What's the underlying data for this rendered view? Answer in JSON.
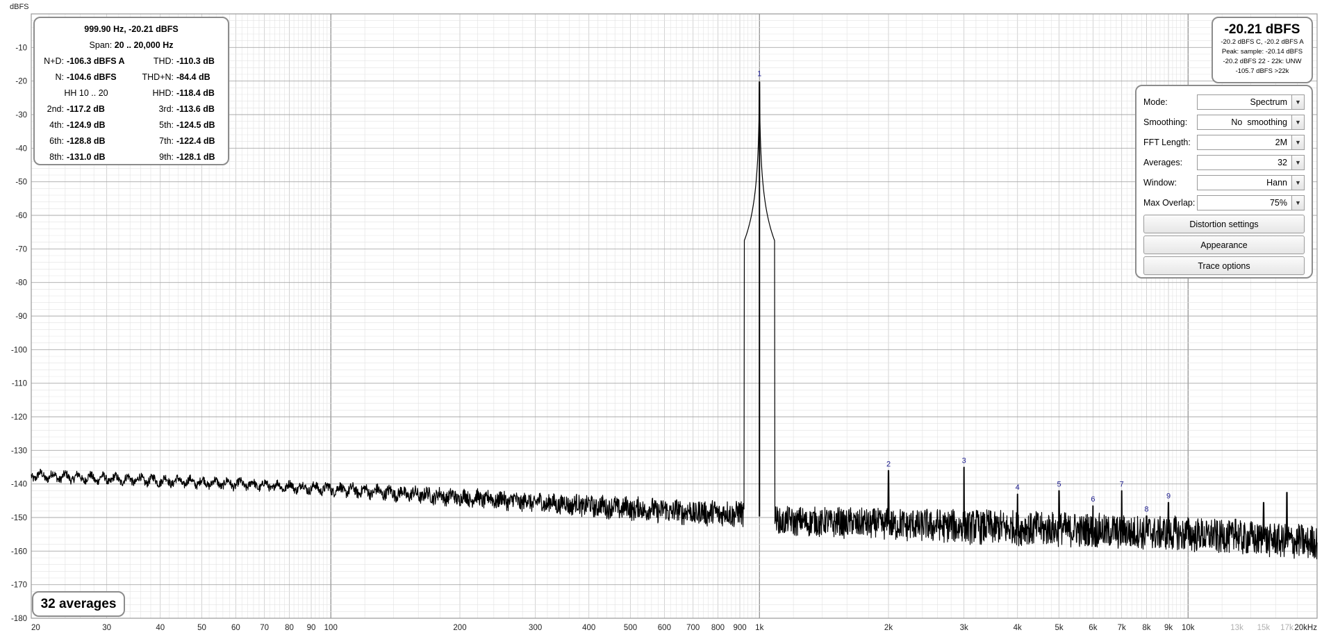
{
  "stats": {
    "line1": "999.90 Hz, -20.21 dBFS",
    "span_label": "Span:",
    "span_value": "20 .. 20,000 Hz",
    "nd_label": "N+D:",
    "nd_value": "-106.3 dBFS A",
    "thd_label": "THD:",
    "thd_value": "-110.3 dB",
    "n_label": "N:",
    "n_value": "-104.6 dBFS",
    "thdn_label": "THD+N:",
    "thdn_value": "-84.4 dB",
    "hh_label": "HH 10 .. 20",
    "hhd_label": "HHD:",
    "hhd_value": "-118.4 dB",
    "h2_label": "2nd:",
    "h2_value": "-117.2 dB",
    "h3_label": "3rd:",
    "h3_value": "-113.6 dB",
    "h4_label": "4th:",
    "h4_value": "-124.9 dB",
    "h5_label": "5th:",
    "h5_value": "-124.5 dB",
    "h6_label": "6th:",
    "h6_value": "-128.8 dB",
    "h7_label": "7th:",
    "h7_value": "-122.4 dB",
    "h8_label": "8th:",
    "h8_value": "-131.0 dB",
    "h9_label": "9th:",
    "h9_value": "-128.1 dB"
  },
  "level": {
    "big": "-20.21 dBFS",
    "line1": "-20.2 dBFS C, -20.2 dBFS A",
    "line2": "Peak: sample: -20.14 dBFS",
    "line3": "-20.2 dBFS 22 - 22k: UNW",
    "line4": "-105.7 dBFS >22k"
  },
  "controls": {
    "mode_label": "Mode:",
    "mode_value": "Spectrum",
    "smoothing_label": "Smoothing:",
    "smoothing_value": "No  smoothing",
    "fft_label": "FFT Length:",
    "fft_value": "2M",
    "averages_label": "Averages:",
    "averages_value": "32",
    "window_label": "Window:",
    "window_value": "Hann",
    "overlap_label": "Max Overlap:",
    "overlap_value": "75%",
    "distortion_button": "Distortion settings",
    "appearance_button": "Appearance",
    "trace_button": "Trace options"
  },
  "averages_badge": "32 averages",
  "icons": {
    "dropdown": "chevron-down-icon"
  },
  "colors": {
    "trace": "#000000",
    "marker_text": "#1a1a8c",
    "grid_major": "#a8a8a8",
    "grid_minor": "#e2e2e2",
    "panel_border": "#8c8c8c"
  },
  "chart_data": {
    "type": "line",
    "ylabel": "dBFS",
    "xscale": "log",
    "xlim": [
      20,
      20000
    ],
    "ylim": [
      -180,
      0
    ],
    "grid": true,
    "y_ticks": [
      -10,
      -20,
      -30,
      -40,
      -50,
      -60,
      -70,
      -80,
      -90,
      -100,
      -110,
      -120,
      -130,
      -140,
      -150,
      -160,
      -170,
      -180
    ],
    "x_ticks": [
      {
        "v": 20,
        "t": "20"
      },
      {
        "v": 30,
        "t": "30"
      },
      {
        "v": 40,
        "t": "40"
      },
      {
        "v": 50,
        "t": "50"
      },
      {
        "v": 60,
        "t": "60"
      },
      {
        "v": 70,
        "t": "70"
      },
      {
        "v": 80,
        "t": "80"
      },
      {
        "v": 90,
        "t": "90"
      },
      {
        "v": 100,
        "t": "100"
      },
      {
        "v": 200,
        "t": "200"
      },
      {
        "v": 300,
        "t": "300"
      },
      {
        "v": 400,
        "t": "400"
      },
      {
        "v": 500,
        "t": "500"
      },
      {
        "v": 600,
        "t": "600"
      },
      {
        "v": 700,
        "t": "700"
      },
      {
        "v": 800,
        "t": "800"
      },
      {
        "v": 900,
        "t": "900"
      },
      {
        "v": 1000,
        "t": "1k"
      },
      {
        "v": 2000,
        "t": "2k"
      },
      {
        "v": 3000,
        "t": "3k"
      },
      {
        "v": 4000,
        "t": "4k"
      },
      {
        "v": 5000,
        "t": "5k"
      },
      {
        "v": 6000,
        "t": "6k"
      },
      {
        "v": 7000,
        "t": "7k"
      },
      {
        "v": 8000,
        "t": "8k"
      },
      {
        "v": 9000,
        "t": "9k"
      },
      {
        "v": 10000,
        "t": "10k"
      },
      {
        "v": 13000,
        "t": "13k",
        "muted": true
      },
      {
        "v": 15000,
        "t": "15k",
        "muted": true
      },
      {
        "v": 17000,
        "t": "17k",
        "muted": true
      },
      {
        "v": 20000,
        "t": "20kHz"
      }
    ],
    "noise_floor": [
      [
        20,
        -137.5
      ],
      [
        25,
        -138
      ],
      [
        30,
        -138.5
      ],
      [
        40,
        -139
      ],
      [
        60,
        -140
      ],
      [
        100,
        -141.5
      ],
      [
        200,
        -144
      ],
      [
        400,
        -146.5
      ],
      [
        700,
        -148.5
      ],
      [
        950,
        -149
      ],
      [
        1100,
        -151
      ],
      [
        2000,
        -152
      ],
      [
        5000,
        -153.5
      ],
      [
        10000,
        -155
      ],
      [
        20000,
        -157.5
      ]
    ],
    "fundamental": {
      "label": "1",
      "freq": 999.9,
      "level": -20.21
    },
    "harmonics": [
      {
        "label": "2",
        "freq": 2000,
        "level": -136.0
      },
      {
        "label": "3",
        "freq": 3000,
        "level": -135.0
      },
      {
        "label": "4",
        "freq": 4000,
        "level": -143.0
      },
      {
        "label": "5",
        "freq": 5000,
        "level": -142.0
      },
      {
        "label": "6",
        "freq": 6000,
        "level": -146.5
      },
      {
        "label": "7",
        "freq": 7000,
        "level": -142.0
      },
      {
        "label": "8",
        "freq": 8000,
        "level": -149.5
      },
      {
        "label": "9",
        "freq": 9000,
        "level": -145.5
      }
    ],
    "spurs": [
      {
        "freq": 12900,
        "level": -150.5
      },
      {
        "freq": 15000,
        "level": -145.5
      },
      {
        "freq": 17000,
        "level": -142.5
      }
    ]
  }
}
